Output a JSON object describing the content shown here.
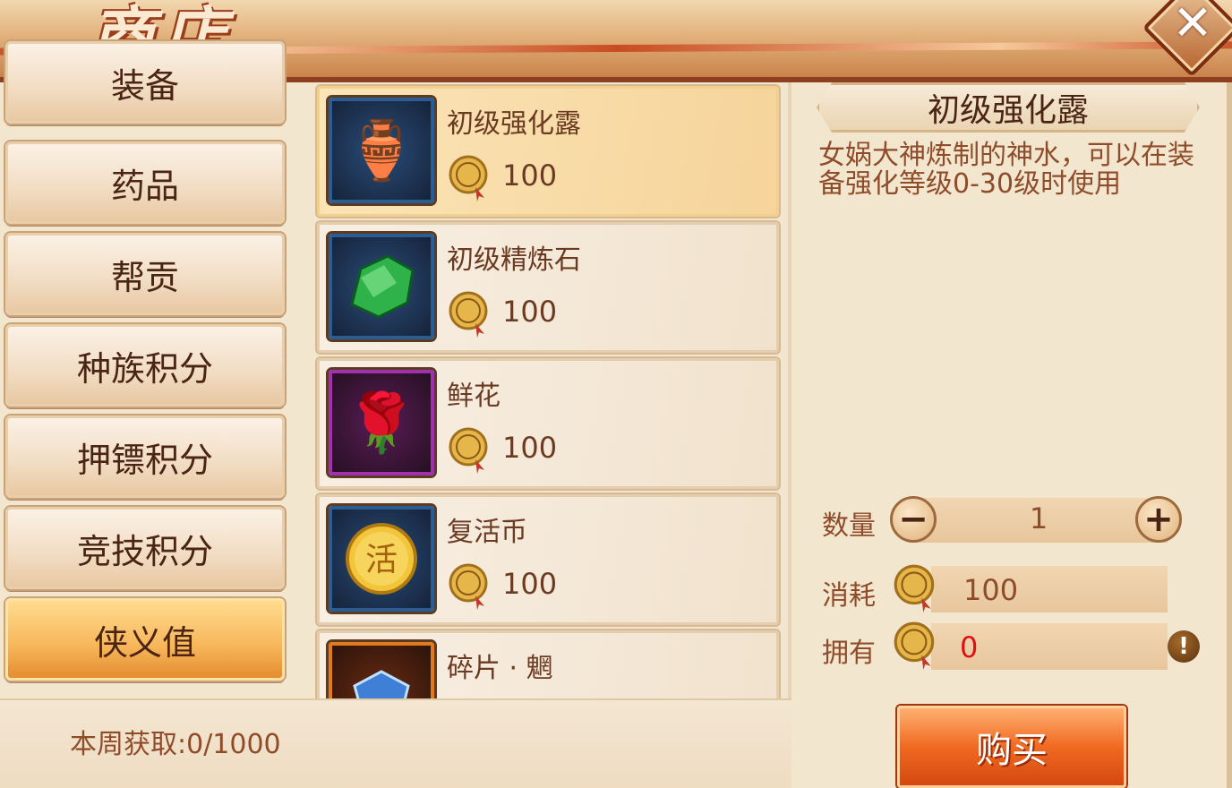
{
  "header": {
    "title": "商店"
  },
  "tabs": [
    {
      "label": "装备"
    },
    {
      "label": "药品"
    },
    {
      "label": "帮贡"
    },
    {
      "label": "种族积分"
    },
    {
      "label": "押镖积分"
    },
    {
      "label": "竞技积分"
    },
    {
      "label": "侠义值"
    }
  ],
  "active_tab": "侠义值",
  "items": [
    {
      "name": "初级强化露",
      "price": "100",
      "icon": "porcelain-vase-icon",
      "selected": true
    },
    {
      "name": "初级精炼石",
      "price": "100",
      "icon": "green-stone-icon"
    },
    {
      "name": "鲜花",
      "price": "100",
      "icon": "rose-icon"
    },
    {
      "name": "复活币",
      "price": "100",
      "icon": "revive-coin-icon",
      "coin_glyph": "活"
    },
    {
      "name": "碎片 · 魍",
      "price": "",
      "icon": "fragment-icon"
    }
  ],
  "weekly": "本周获取:0/1000",
  "detail": {
    "title": "初级强化露",
    "description": "女娲大神炼制的神水，可以在装备强化等级0-30级时使用",
    "qty_label": "数量",
    "qty_value": "1",
    "cost_label": "消耗",
    "cost_value": "100",
    "own_label": "拥有",
    "own_value": "0",
    "minus": "−",
    "plus": "+",
    "warn": "!"
  },
  "buy_label": "购买",
  "colors": {
    "accent_orange": "#f06a22",
    "text_brown": "#8f4c2a",
    "owned_red": "#e01010"
  }
}
